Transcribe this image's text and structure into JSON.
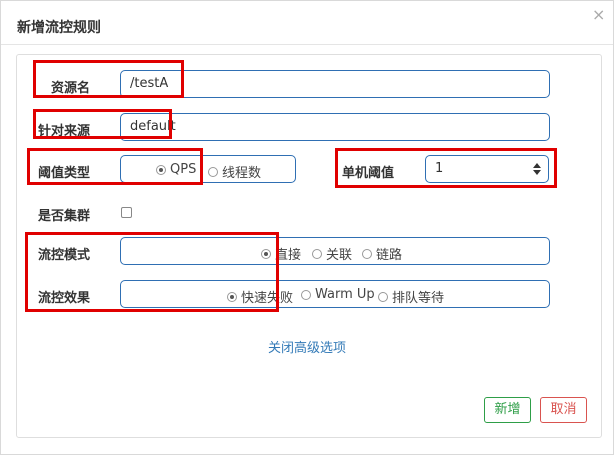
{
  "dialog": {
    "title": "新增流控规则",
    "close_glyph": "×"
  },
  "form": {
    "resource": {
      "label": "资源名",
      "value": "/testA"
    },
    "limit_app": {
      "label": "针对来源",
      "value": "default"
    },
    "grade": {
      "label": "阈值类型",
      "options": [
        "QPS",
        "线程数"
      ],
      "selected": "QPS"
    },
    "count": {
      "label": "单机阈值",
      "value": "1"
    },
    "cluster": {
      "label": "是否集群",
      "checked": false
    },
    "strategy": {
      "label": "流控模式",
      "options": [
        "直接",
        "关联",
        "链路"
      ],
      "selected": "直接"
    },
    "control": {
      "label": "流控效果",
      "options": [
        "快速失败",
        "Warm Up",
        "排队等待"
      ],
      "selected": "快速失败"
    }
  },
  "advanced_link": "关闭高级选项",
  "buttons": {
    "add": "新增",
    "cancel": "取消"
  },
  "colors": {
    "highlight": "#e00000",
    "primary_border": "#2f6fb3",
    "link": "#337ab7",
    "add": "#2e9e47",
    "cancel": "#d9534f"
  }
}
